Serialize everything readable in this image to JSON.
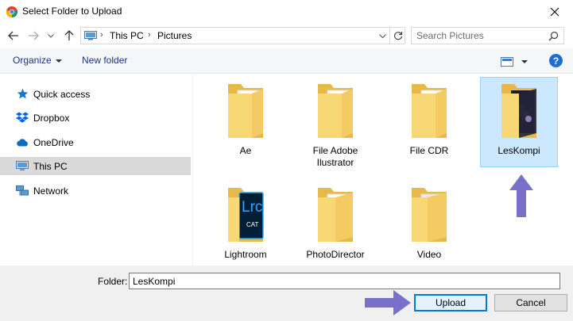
{
  "window": {
    "title": "Select Folder to Upload"
  },
  "address": {
    "crumbs": [
      "This PC",
      "Pictures"
    ]
  },
  "search": {
    "placeholder": "Search Pictures"
  },
  "toolbar": {
    "organize_label": "Organize",
    "new_folder_label": "New folder",
    "help_label": "?"
  },
  "sidebar": {
    "items": [
      {
        "label": "Quick access",
        "icon": "star-icon"
      },
      {
        "label": "Dropbox",
        "icon": "dropbox-icon"
      },
      {
        "label": "OneDrive",
        "icon": "cloud-icon"
      },
      {
        "label": "This PC",
        "icon": "computer-icon",
        "selected": true
      },
      {
        "label": "Network",
        "icon": "network-icon"
      }
    ]
  },
  "folders": [
    {
      "label": "Ae"
    },
    {
      "label": "File Adobe Ilustrator"
    },
    {
      "label": "File CDR"
    },
    {
      "label": "LesKompi",
      "selected": true
    },
    {
      "label": "Lightroom",
      "badge": "Lrc",
      "badge_sub": "CAT"
    },
    {
      "label": "PhotoDirector"
    },
    {
      "label": "Video"
    }
  ],
  "footer": {
    "folder_label": "Folder:",
    "folder_value": "LesKompi",
    "upload_label": "Upload",
    "cancel_label": "Cancel"
  },
  "colors": {
    "accent": "#0078d7",
    "selection": "#cce8ff",
    "annotation_arrow": "#7b70c9",
    "folder": "#f8d775"
  }
}
